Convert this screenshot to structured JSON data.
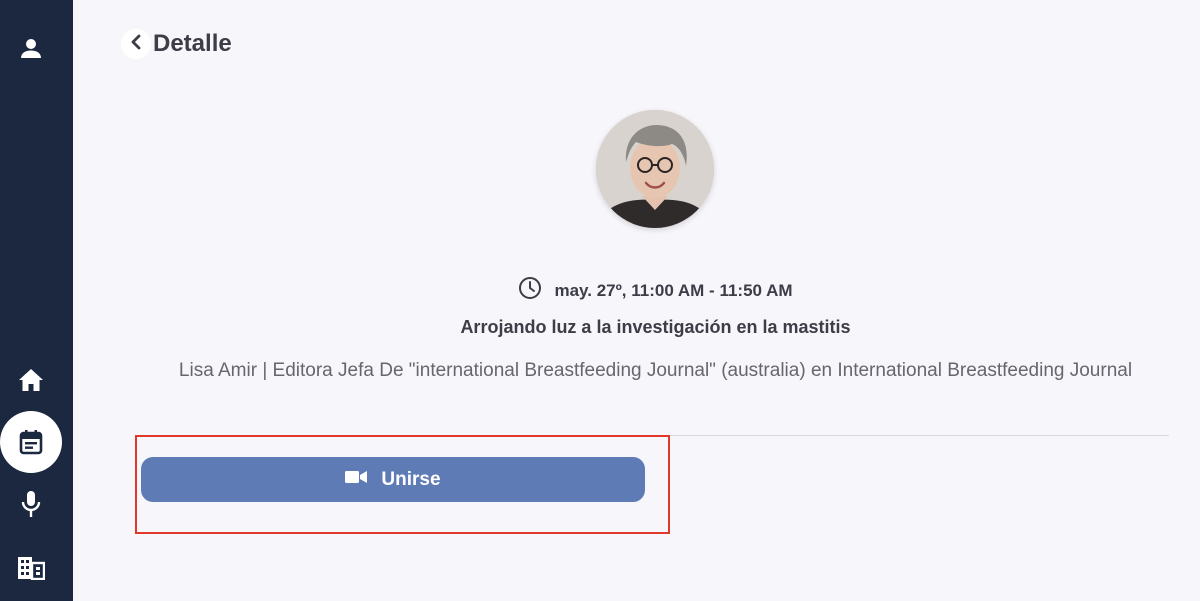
{
  "header": {
    "title": "Detalle"
  },
  "session": {
    "time": "may. 27º, 11:00 AM - 11:50 AM",
    "title": "Arrojando luz a la investigación en la mastitis",
    "speaker": "Lisa Amir | Editora Jefa De \"international Breastfeeding Journal\" (australia) en International Breastfeeding Journal"
  },
  "actions": {
    "join_label": "Unirse"
  },
  "icons": {
    "profile": "user-icon",
    "home": "home-icon",
    "agenda": "calendar-icon",
    "speakers": "microphone-icon",
    "exhibitors": "building-icon",
    "back": "chevron-left-icon",
    "clock": "clock-icon",
    "video": "video-camera-icon"
  },
  "colors": {
    "sidebar": "#1c2740",
    "accent": "#5f7bb5",
    "highlight": "#e0392b",
    "background": "#f7f6fa"
  }
}
